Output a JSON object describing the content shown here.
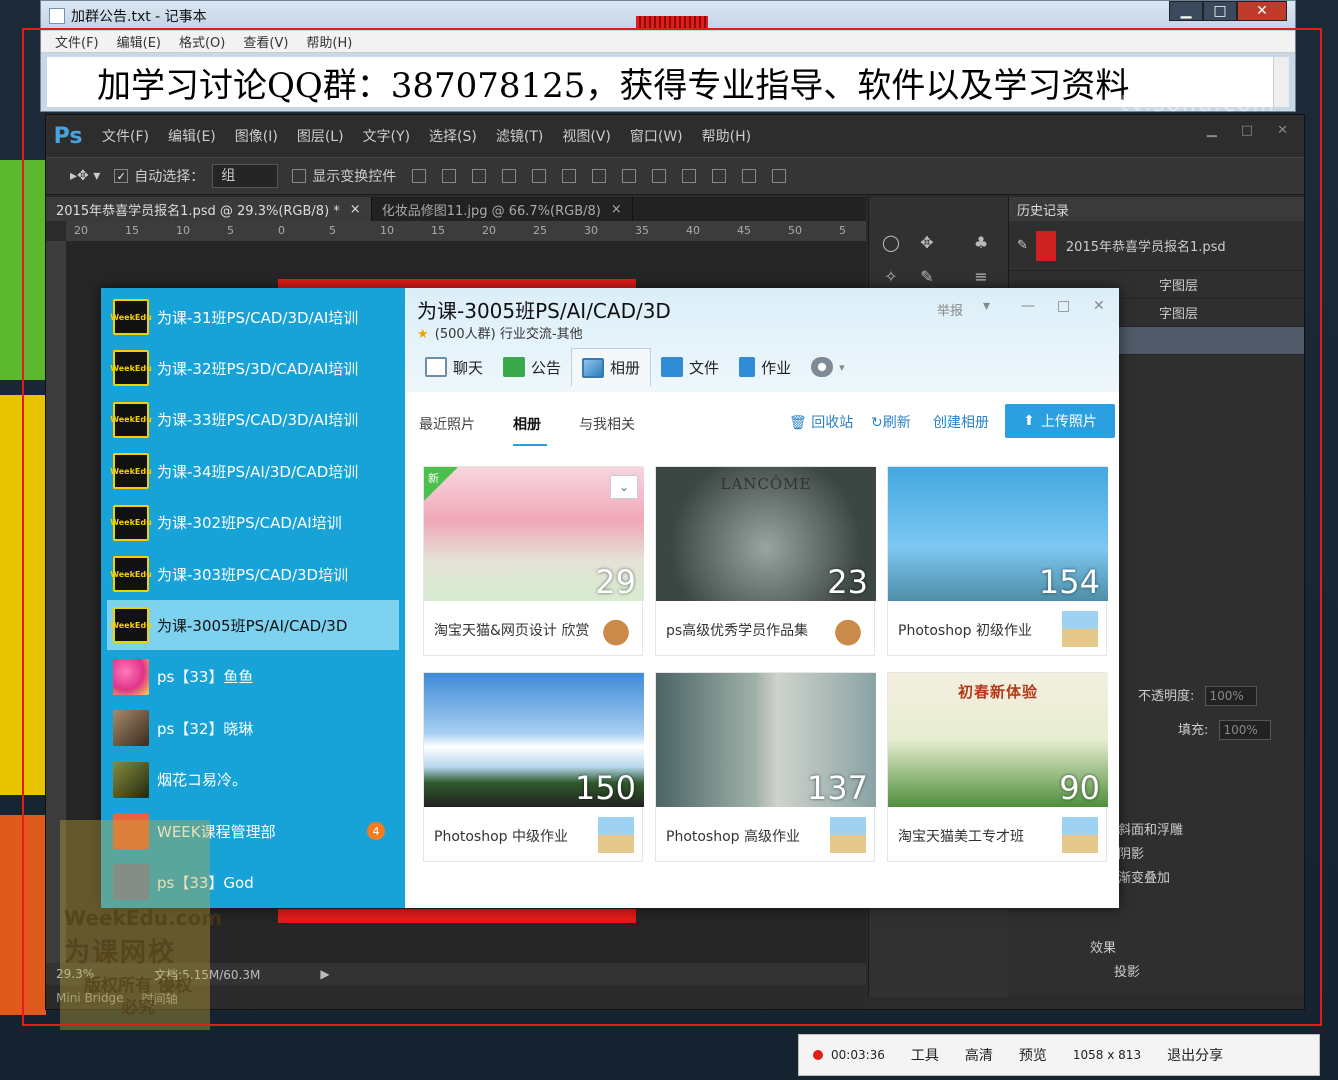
{
  "notepad": {
    "title": "加群公告.txt - 记事本",
    "menu": [
      "文件(F)",
      "编辑(E)",
      "格式(O)",
      "查看(V)",
      "帮助(H)"
    ],
    "content": "加学习讨论QQ群：387078125，获得专业指导、软件以及学习资料"
  },
  "watermark": "tv.sohu.com",
  "photoshop": {
    "logo": "Ps",
    "menu": [
      "文件(F)",
      "编辑(E)",
      "图像(I)",
      "图层(L)",
      "文字(Y)",
      "选择(S)",
      "滤镜(T)",
      "视图(V)",
      "窗口(W)",
      "帮助(H)"
    ],
    "options": {
      "auto_select_label": "自动选择：",
      "auto_select_value": "组",
      "show_transform_label": "显示变换控件"
    },
    "tabs": [
      "2015年恭喜学员报名1.psd @ 29.3%(RGB/8) *",
      "化妆品修图11.jpg @ 66.7%(RGB/8)"
    ],
    "ruler_h": [
      "20",
      "15",
      "10",
      "5",
      "0",
      "5",
      "10",
      "15",
      "20",
      "25",
      "30",
      "35",
      "40",
      "45",
      "50",
      "5"
    ],
    "status": {
      "zoom": "29.3%",
      "doc": "文档:5.15M/60.3M"
    },
    "minibridge": [
      "Mini Bridge",
      "时间轴"
    ],
    "history": {
      "title": "历史记录",
      "rows": [
        "2015年恭喜学员报名1.psd",
        "字图层",
        "字图层",
        ""
      ]
    },
    "layers": {
      "opacity_label": "不透明度:",
      "opacity_value": "100%",
      "fill_label": "填充:",
      "fill_value": "100%",
      "effects": [
        "斜面和浮雕",
        "阴影",
        "渐变叠加"
      ],
      "effect2": [
        "效果",
        "投影"
      ]
    }
  },
  "qq": {
    "sidebar": [
      {
        "label": "为课-31班PS/CAD/3D/AI培训",
        "avatar": "WeekEdu",
        "active": false
      },
      {
        "label": "为课-32班PS/3D/CAD/AI培训",
        "avatar": "WeekEdu",
        "active": false
      },
      {
        "label": "为课-33班PS/CAD/3D/AI培训",
        "avatar": "WeekEdu",
        "active": false
      },
      {
        "label": "为课-34班PS/AI/3D/CAD培训",
        "avatar": "WeekEdu",
        "active": false
      },
      {
        "label": "为课-302班PS/CAD/AI培训",
        "avatar": "WeekEdu",
        "active": false
      },
      {
        "label": "为课-303班PS/CAD/3D培训",
        "avatar": "WeekEdu",
        "active": false
      },
      {
        "label": "为课-3005班PS/AI/CAD/3D",
        "avatar": "WeekEdu",
        "active": true
      },
      {
        "label": "ps【33】鱼鱼",
        "avatar": "flower",
        "active": false
      },
      {
        "label": "ps【32】晓琳",
        "avatar": "girl",
        "active": false
      },
      {
        "label": "烟花コ易冷。",
        "avatar": "night",
        "active": false
      },
      {
        "label": "WEEK课程管理部",
        "avatar": "admin",
        "active": false,
        "badge": "4"
      },
      {
        "label": "ps【33】God",
        "avatar": "god",
        "active": false
      }
    ],
    "title": "为课-3005班PS/AI/CAD/3D",
    "subtitle": "(500人群) 行业交流-其他",
    "report": "举报",
    "tabs": [
      "聊天",
      "公告",
      "相册",
      "文件",
      "作业"
    ],
    "subnav": [
      "最近照片",
      "相册",
      "与我相关"
    ],
    "actions": [
      "回收站",
      "刷新",
      "创建相册"
    ],
    "upload": "上传照片",
    "albums": [
      {
        "name": "淘宝天猫&网页设计 欣赏",
        "count": "29",
        "new_tag": "新",
        "thumb_label": ""
      },
      {
        "name": "ps高级优秀学员作品集",
        "count": "23",
        "thumb_label": "LANCÔME"
      },
      {
        "name": "Photoshop 初级作业",
        "count": "154",
        "thumb_label": ""
      },
      {
        "name": "Photoshop 中级作业",
        "count": "150",
        "thumb_label": ""
      },
      {
        "name": "Photoshop 高级作业",
        "count": "137",
        "thumb_label": ""
      },
      {
        "name": "淘宝天猫美工专才班",
        "count": "90",
        "thumb_label": "初春新体验"
      }
    ]
  },
  "weekedu": {
    "line1": "WeekEdu.com",
    "line2": "为课网校",
    "line3": "版权所有 侵权必究"
  },
  "recorder": {
    "time": "00:03:36",
    "tools": "工具",
    "quality": "高清",
    "preview": "预览",
    "size": "1058 x 813",
    "exit": "退出分享"
  }
}
